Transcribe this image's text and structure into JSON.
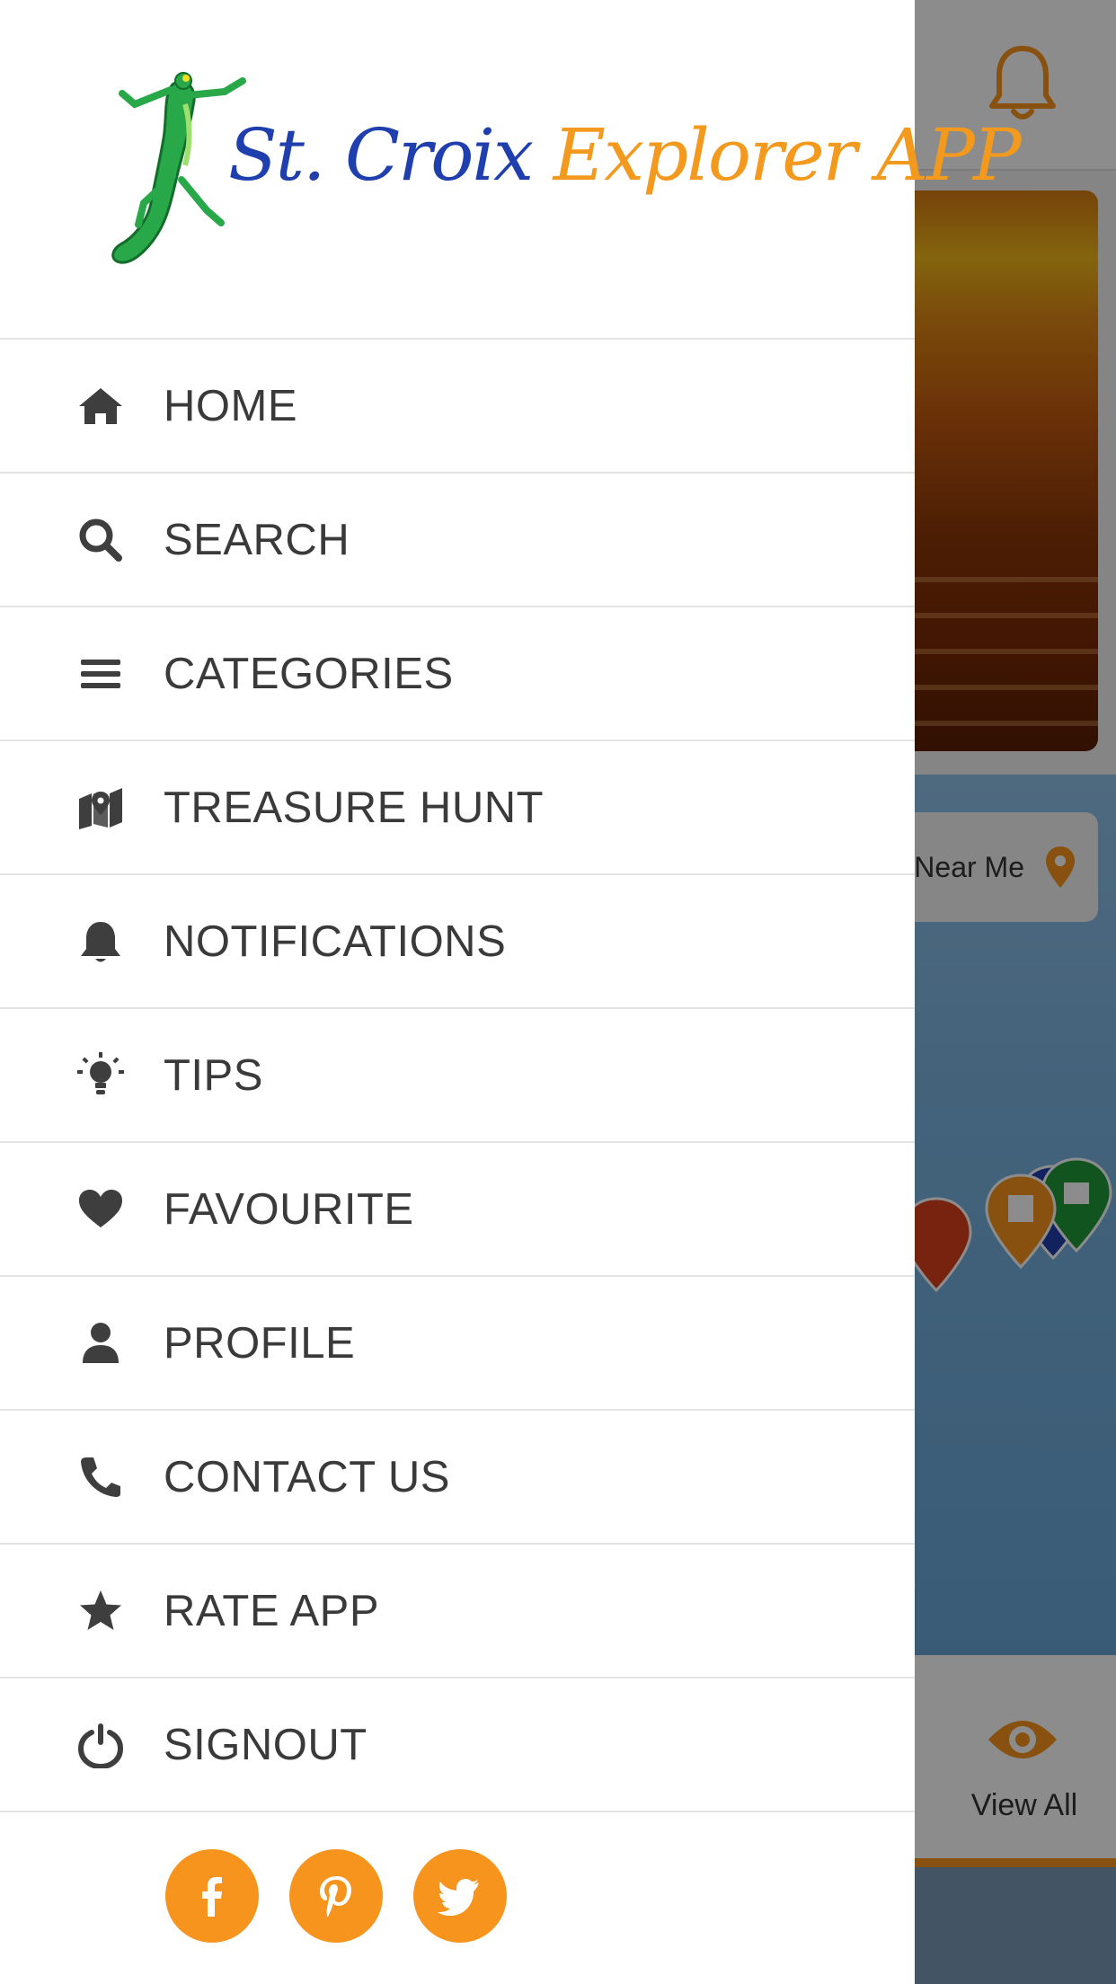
{
  "app": {
    "logo": {
      "title_part1": "St. Croix",
      "title_part2": "Explorer APP"
    }
  },
  "menu": {
    "items": [
      {
        "label": "HOME",
        "icon": "home-icon"
      },
      {
        "label": "SEARCH",
        "icon": "search-icon"
      },
      {
        "label": "CATEGORIES",
        "icon": "list-icon"
      },
      {
        "label": "TREASURE HUNT",
        "icon": "map-marker-icon"
      },
      {
        "label": "NOTIFICATIONS",
        "icon": "bell-icon"
      },
      {
        "label": "TIPS",
        "icon": "lightbulb-icon"
      },
      {
        "label": "FAVOURITE",
        "icon": "heart-icon"
      },
      {
        "label": "PROFILE",
        "icon": "user-icon"
      },
      {
        "label": "CONTACT US",
        "icon": "phone-icon"
      },
      {
        "label": "RATE APP",
        "icon": "star-icon"
      },
      {
        "label": "SIGNOUT",
        "icon": "power-icon"
      }
    ]
  },
  "social": [
    {
      "icon": "facebook-icon"
    },
    {
      "icon": "pinterest-icon"
    },
    {
      "icon": "twitter-icon"
    }
  ],
  "background": {
    "near_me_label": "Near Me",
    "view_all_label": "View All"
  },
  "colors": {
    "accent": "#f7941d",
    "logo_blue": "#1f3fae",
    "logo_orange": "#f39a1e",
    "menu_text": "#3a3a3a",
    "drawer_bg": "#ffffff"
  }
}
